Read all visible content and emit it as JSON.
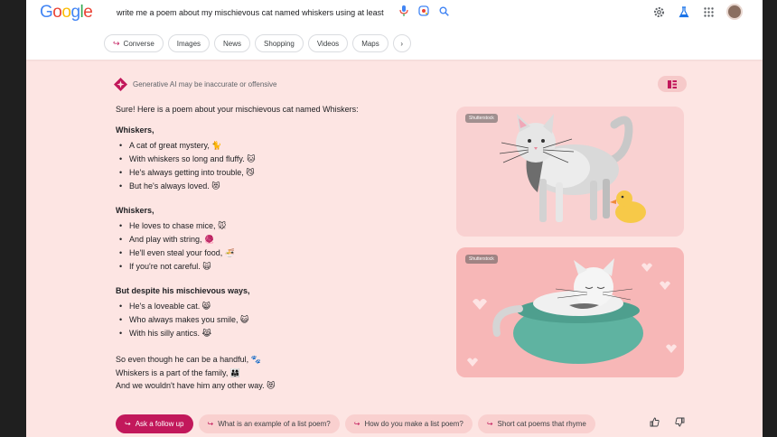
{
  "header": {
    "logo": [
      "G",
      "o",
      "o",
      "g",
      "l",
      "e"
    ],
    "logo_colors": [
      "#4285F4",
      "#EA4335",
      "#FBBC05",
      "#4285F4",
      "#34A853",
      "#EA4335"
    ],
    "search_value": "write me a poem about my mischievous cat named whiskers using at least",
    "icons": [
      "microphone-icon",
      "lens-icon",
      "search-icon",
      "labs-settings-icon",
      "labs-flask-icon",
      "apps-grid-icon",
      "avatar"
    ]
  },
  "chips": [
    {
      "label": "Converse",
      "arrow": "↪"
    },
    {
      "label": "Images"
    },
    {
      "label": "News"
    },
    {
      "label": "Shopping"
    },
    {
      "label": "Videos"
    },
    {
      "label": "Maps"
    },
    {
      "label": "›"
    }
  ],
  "ai": {
    "notice": "Generative AI may be inaccurate or offensive",
    "accent": "#c2185b"
  },
  "poem": {
    "intro": "Sure! Here is a poem about your mischievous cat named Whiskers:",
    "stanzas": [
      {
        "title": "Whiskers,",
        "lines": [
          "A cat of great mystery, 🐈",
          "With whiskers so long and fluffy. 🐱",
          "He's always getting into trouble, 😼",
          "But he's always loved. 😻"
        ]
      },
      {
        "title": "Whiskers,",
        "lines": [
          "He loves to chase mice, 🐭",
          "And play with string, 🧶",
          "He'll even steal your food, 🍜",
          "If you're not careful. 🙀"
        ]
      },
      {
        "title": "But despite his mischievous ways,",
        "lines": [
          "He's a loveable cat. 😸",
          "Who always makes you smile, 😺",
          "With his silly antics. 😹"
        ]
      }
    ],
    "closing": [
      "So even though he can be a handful, 🐾",
      "Whiskers is a part of the family, 👨‍👩‍👧",
      "And we wouldn't have him any other way. 😻"
    ]
  },
  "images": [
    {
      "badge": "Shutterstock"
    },
    {
      "badge": "Shutterstock"
    }
  ],
  "followups": [
    {
      "label": "Ask a follow up",
      "arrow": "↪"
    },
    {
      "label": "What is an example of a list poem?",
      "arrow": "↪"
    },
    {
      "label": "How do you make a list poem?",
      "arrow": "↪"
    },
    {
      "label": "Short cat poems that rhyme",
      "arrow": "↪"
    }
  ]
}
